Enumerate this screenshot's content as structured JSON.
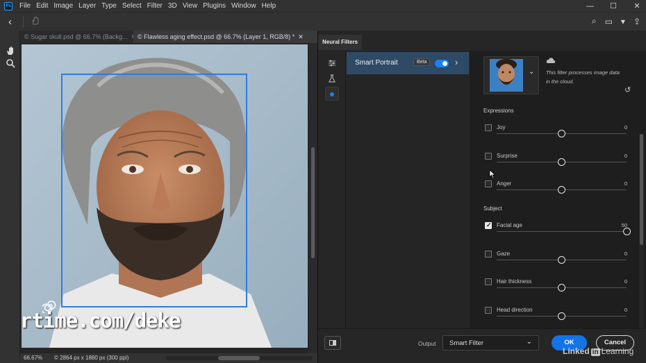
{
  "app": {
    "logo_text": "Ps"
  },
  "menu": {
    "items": [
      "File",
      "Edit",
      "Image",
      "Layer",
      "Type",
      "Select",
      "Filter",
      "3D",
      "View",
      "Plugins",
      "Window",
      "Help"
    ],
    "window_controls": {
      "minimize": "—",
      "maximize": "☐",
      "close": "✕"
    }
  },
  "options_bar": {
    "back": "‹",
    "right": {
      "search": "⌕",
      "workspace": "▭",
      "dropdown": "▾",
      "share": "⇪"
    }
  },
  "tabs": [
    {
      "label": "© Sugar skull.psd @ 66.7% (Backg...",
      "close": "✕",
      "active": false
    },
    {
      "label": "© Flawless aging effect.psd @ 66.7% (Layer 1, RGB/8) *",
      "close": "✕",
      "active": true
    }
  ],
  "status": {
    "zoom": "66.67%",
    "doc_info": "© 2864 px x 1880 px (300 ppi)",
    "arrow": "›"
  },
  "watermark": {
    "text": "rtime.com/deke"
  },
  "neural_filters": {
    "panel_title": "Neural Filters",
    "sidebar_icons": [
      "sliders-icon",
      "flask-icon",
      "dot-icon"
    ],
    "filter": {
      "name": "Smart Portrait",
      "badge": "Beta",
      "enabled": true,
      "chevron": "›"
    },
    "cloud_text": "This filter processes image data in the cloud.",
    "portrait_chevron": "⌄",
    "reset": "↺",
    "sections": [
      {
        "title": "Expressions",
        "sliders": [
          {
            "label": "Joy",
            "value": "0",
            "checked": false,
            "level": 0.5
          },
          {
            "label": "Surprise",
            "value": "0",
            "checked": false,
            "level": 0.5
          },
          {
            "label": "Anger",
            "value": "0",
            "checked": false,
            "level": 0.5
          }
        ]
      },
      {
        "title": "Subject",
        "sliders": [
          {
            "label": "Facial age",
            "value": "50",
            "checked": true,
            "level": 1.0
          },
          {
            "label": "Gaze",
            "value": "0",
            "checked": false,
            "level": 0.5
          },
          {
            "label": "Hair thickness",
            "value": "0",
            "checked": false,
            "level": 0.5
          },
          {
            "label": "Head direction",
            "value": "0",
            "checked": false,
            "level": 0.5
          }
        ]
      }
    ],
    "output": {
      "label": "Output",
      "value": "Smart Filter",
      "chevron": "⌄"
    },
    "ok": "OK",
    "cancel": "Cancel",
    "linkedin": {
      "linked": "Linked",
      "in": "in",
      "learning": "Learning"
    },
    "colors": {
      "accent": "#1473e6",
      "selected_row": "#2e4a66",
      "face_box": "#2f7be0"
    }
  }
}
